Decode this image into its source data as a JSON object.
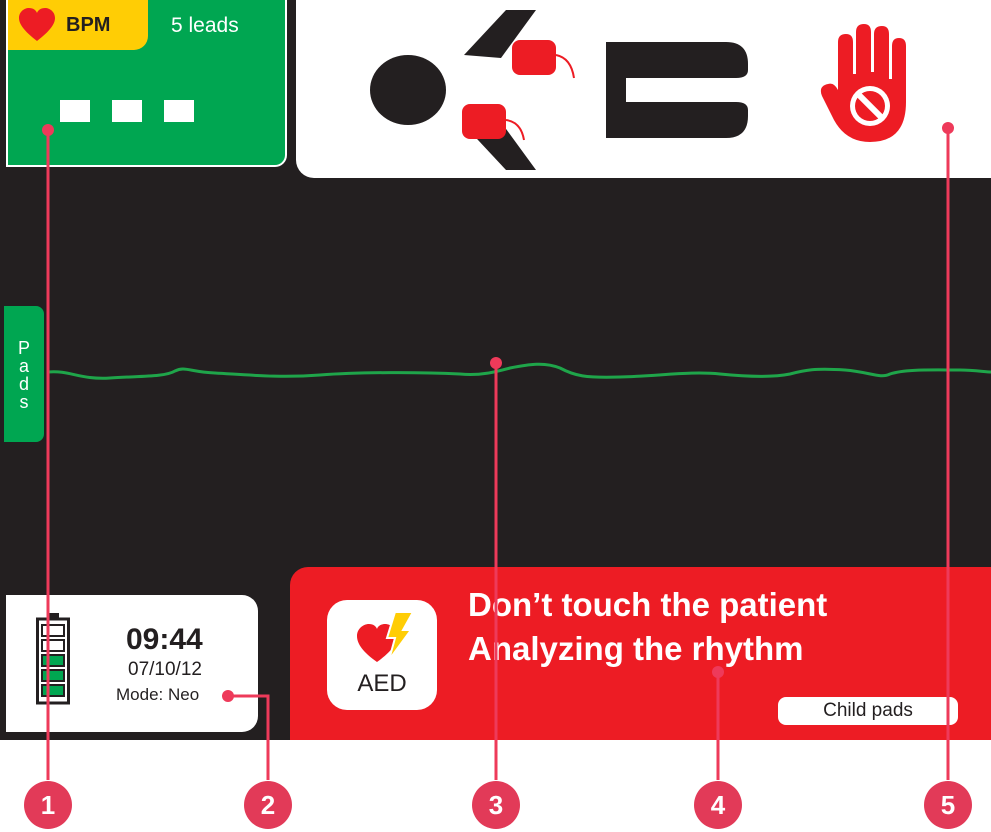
{
  "colors": {
    "screen": "#231f20",
    "green": "#00a651",
    "yellow": "#ffcd05",
    "alarm_red": "#ed1c24",
    "callout": "#e23a58",
    "ecg_trace": "#1fa54a"
  },
  "heart_rate_panel": {
    "badge_label": "BPM",
    "leads_label": "5 leads",
    "value_display": "- - -",
    "icon": "heart-icon"
  },
  "patient_panel": {
    "icons": [
      "patient-pads-placement-icon",
      "do-not-touch-hand-icon"
    ]
  },
  "pads_tab": {
    "label": "Pads"
  },
  "status_panel": {
    "time": "09:44",
    "date": "07/10/12",
    "mode": "Mode: Neo",
    "battery_icon": "battery-icon",
    "battery_level_bars": 3,
    "battery_total_bars": 5
  },
  "alarm_panel": {
    "aed_label": "AED",
    "message_line1": "Don’t touch the patient",
    "message_line2": "Analyzing the rhythm",
    "child_pads_label": "Child pads",
    "icon": "aed-heart-lightning-icon"
  },
  "callouts": [
    {
      "number": "1"
    },
    {
      "number": "2"
    },
    {
      "number": "3"
    },
    {
      "number": "4"
    },
    {
      "number": "5"
    }
  ]
}
